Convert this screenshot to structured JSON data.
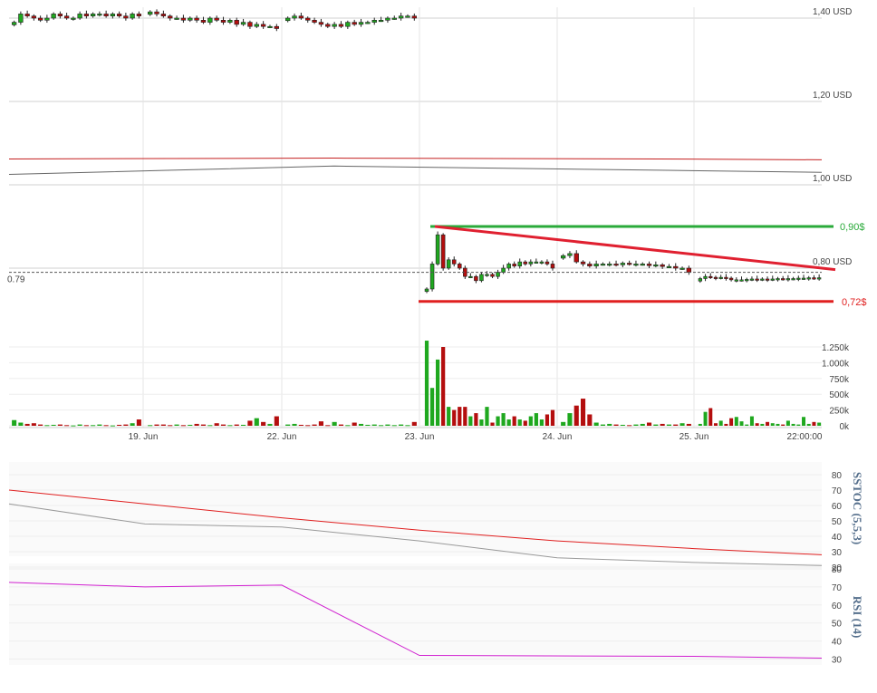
{
  "colors": {
    "up": "#1fa81f",
    "down": "#b40e0e",
    "grid": "#d0d0d0",
    "resistance": "#2aaa3a",
    "support": "#e02020",
    "trendline": "#e02030",
    "stoch_k": "#e02020",
    "stoch_d": "#999999",
    "rsi": "#d020d0",
    "ma_red": "#c42020",
    "ma_grey": "#666666",
    "indicator_label": "#556f8c"
  },
  "chart_data": [
    {
      "type": "candlestick",
      "currency": "USD",
      "ylim": [
        0.7,
        1.43
      ],
      "y_ticks": [
        {
          "value": 1.4,
          "label": "1,40 USD"
        },
        {
          "value": 1.2,
          "label": "1,20 USD"
        },
        {
          "value": 1.0,
          "label": "1,00 USD"
        },
        {
          "value": 0.8,
          "label": "0,80 USD"
        }
      ],
      "x_ticks": [
        "19. Jun",
        "22. Jun",
        "23. Jun",
        "24. Jun",
        "25. Jun",
        "22:00:00"
      ],
      "last_price": 0.79,
      "last_price_label": "0.79",
      "resistance": {
        "value": 0.9,
        "label": "0,90$"
      },
      "support": {
        "value": 0.72,
        "label": "0,72$"
      },
      "trendline": {
        "start": 0.9,
        "end": 0.79
      },
      "moving_averages": [
        {
          "color": "ma_red",
          "points": [
            1.062,
            1.063,
            1.064,
            1.063,
            1.062,
            1.06
          ]
        },
        {
          "color": "ma_grey",
          "points": [
            1.025,
            1.035,
            1.045,
            1.04,
            1.035,
            1.03
          ]
        }
      ],
      "session_closes": [
        [
          1.39,
          1.41,
          1.405,
          1.4,
          1.395,
          1.4,
          1.41,
          1.405,
          1.4,
          1.4,
          1.41,
          1.405,
          1.41,
          1.41,
          1.405,
          1.41,
          1.405,
          1.4,
          1.41,
          1.405
        ],
        [
          1.415,
          1.41,
          1.405,
          1.4,
          1.4,
          1.395,
          1.4,
          1.395,
          1.39,
          1.4,
          1.395,
          1.39,
          1.395,
          1.385,
          1.39,
          1.38,
          1.385,
          1.38,
          1.38,
          1.375
        ],
        [
          1.4,
          1.405,
          1.4,
          1.395,
          1.39,
          1.385,
          1.38,
          1.385,
          1.38,
          1.39,
          1.385,
          1.39,
          1.39,
          1.395,
          1.395,
          1.4,
          1.4,
          1.405,
          1.405,
          1.4
        ],
        [
          0.75,
          0.81,
          0.88,
          0.8,
          0.82,
          0.81,
          0.8,
          0.78,
          0.78,
          0.77,
          0.785,
          0.785,
          0.78,
          0.79,
          0.8,
          0.81,
          0.805,
          0.815,
          0.81,
          0.815,
          0.815,
          0.815,
          0.81,
          0.8
        ],
        [
          0.83,
          0.835,
          0.815,
          0.81,
          0.805,
          0.81,
          0.81,
          0.81,
          0.808,
          0.812,
          0.81,
          0.81,
          0.81,
          0.806,
          0.808,
          0.804,
          0.804,
          0.8,
          0.8,
          0.79
        ],
        [
          0.775,
          0.78,
          0.778,
          0.777,
          0.778,
          0.776,
          0.772,
          0.772,
          0.772,
          0.773,
          0.774,
          0.773,
          0.774,
          0.773,
          0.774,
          0.775,
          0.774,
          0.775,
          0.775,
          0.776,
          0.776,
          0.777,
          0.776,
          0.777
        ]
      ]
    },
    {
      "type": "bar",
      "name": "volume",
      "ylim": [
        0,
        1350000
      ],
      "y_ticks": [
        {
          "value": 1250000,
          "label": "1.250k"
        },
        {
          "value": 1000000,
          "label": "1.000k"
        },
        {
          "value": 750000,
          "label": "750k"
        },
        {
          "value": 500000,
          "label": "500k"
        },
        {
          "value": 250000,
          "label": "250k"
        },
        {
          "value": 0,
          "label": "0k"
        }
      ],
      "session_values": [
        [
          90000,
          50000,
          30000,
          40000,
          20000,
          10000,
          15000,
          20000,
          10000,
          5000,
          20000,
          10000,
          10000,
          20000,
          10000,
          5000,
          15000,
          20000,
          40000,
          100000
        ],
        [
          10000,
          20000,
          20000,
          10000,
          20000,
          10000,
          15000,
          30000,
          20000,
          10000,
          40000,
          20000,
          10000,
          20000,
          15000,
          80000,
          120000,
          60000,
          30000,
          150000
        ],
        [
          20000,
          30000,
          15000,
          10000,
          20000,
          70000,
          10000,
          60000,
          20000,
          10000,
          50000,
          30000,
          15000,
          20000,
          10000,
          20000,
          10000,
          20000,
          10000,
          60000
        ],
        [
          1350000,
          600000,
          1050000,
          1250000,
          300000,
          250000,
          300000,
          300000,
          150000,
          200000,
          100000,
          300000,
          50000,
          150000,
          200000,
          100000,
          150000,
          100000,
          80000,
          150000,
          200000,
          100000,
          180000,
          250000
        ],
        [
          60000,
          200000,
          320000,
          430000,
          180000,
          50000,
          20000,
          30000,
          20000,
          15000,
          10000,
          20000,
          30000,
          50000,
          20000,
          30000,
          20000,
          20000,
          40000,
          30000
        ],
        [
          30000,
          220000,
          280000,
          40000,
          80000,
          30000,
          120000,
          140000,
          70000,
          20000,
          150000,
          40000,
          30000,
          60000,
          40000,
          30000,
          20000,
          80000,
          30000,
          20000,
          140000,
          30000,
          60000,
          50000
        ]
      ]
    },
    {
      "type": "line",
      "indicator": "SSTOC (5,5,3)",
      "ylim": [
        20,
        80
      ],
      "y_ticks": [
        80,
        70,
        60,
        50,
        40,
        30,
        20
      ],
      "series": [
        {
          "color": "stoch_k",
          "values": [
            70,
            61,
            52,
            44,
            37,
            32,
            28
          ]
        },
        {
          "color": "stoch_d",
          "values": [
            61,
            48,
            46,
            37,
            26,
            23,
            21
          ]
        }
      ]
    },
    {
      "type": "line",
      "indicator": "RSI (14)",
      "ylim": [
        30,
        80
      ],
      "y_ticks": [
        80,
        70,
        60,
        50,
        40,
        30
      ],
      "series": [
        {
          "color": "rsi",
          "values": [
            72.5,
            70,
            71,
            32,
            31.5,
            30.5
          ]
        }
      ]
    }
  ]
}
